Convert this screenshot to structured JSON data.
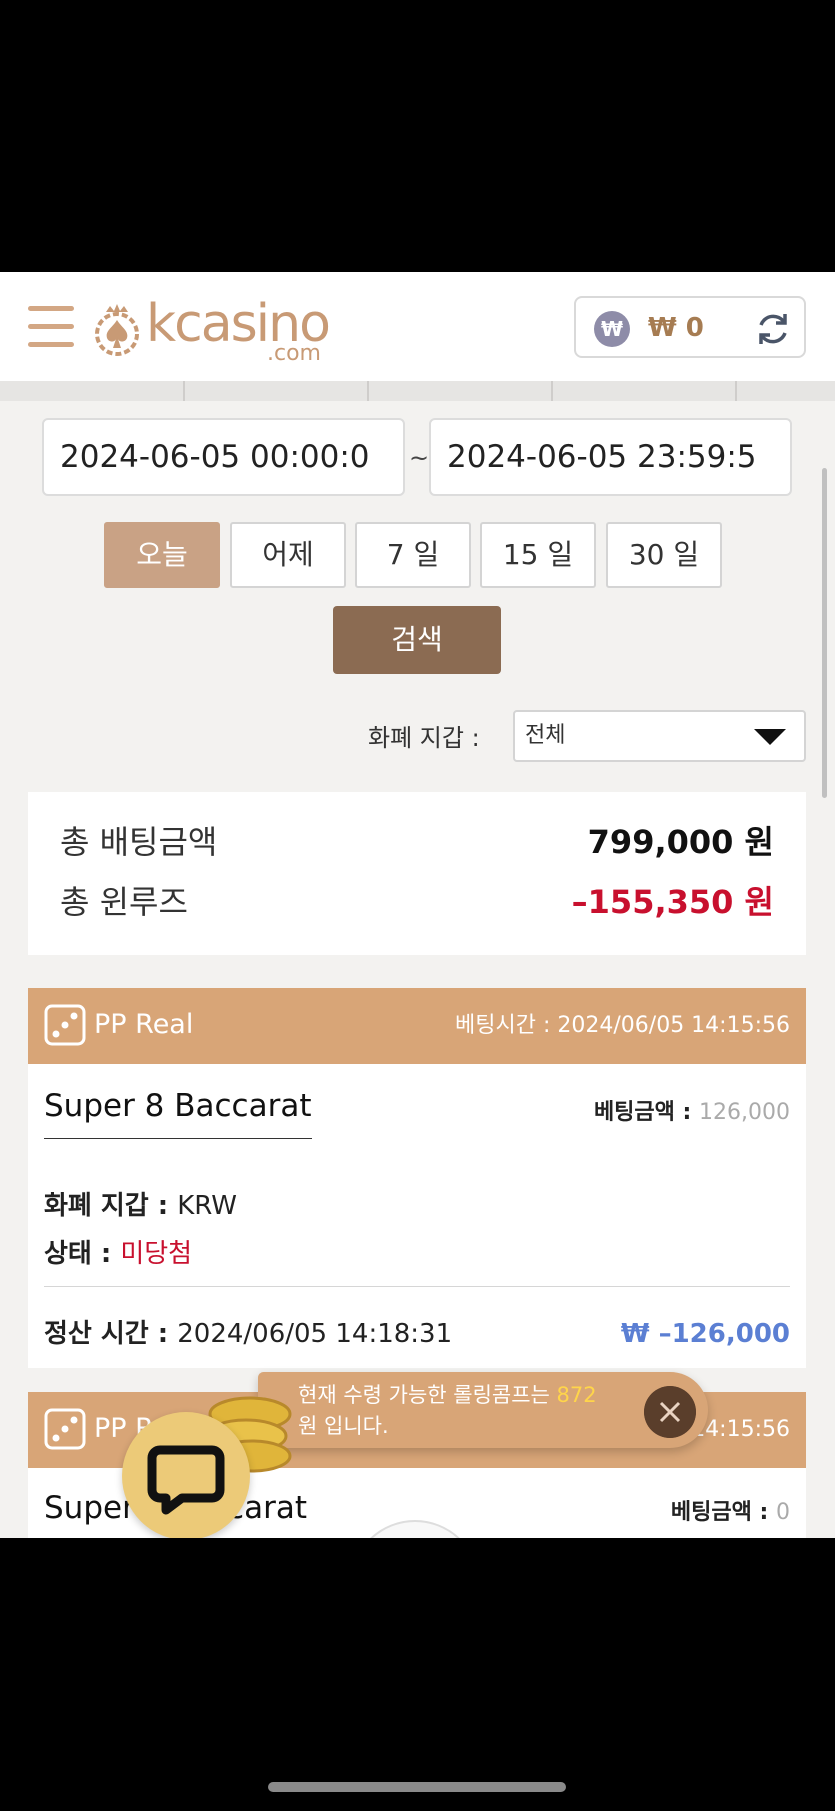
{
  "header": {
    "logo_text": "kcasino",
    "logo_sub": ".com",
    "wallet_symbol": "₩",
    "wallet_amount": "₩ 0"
  },
  "filters": {
    "date_from": "2024-06-05 00:00:0",
    "date_separator": "~",
    "date_to": "2024-06-05 23:59:5",
    "ranges": [
      "오늘",
      "어제",
      "7 일",
      "15 일",
      "30 일"
    ],
    "active_range": "오늘",
    "search_label": "검색",
    "wallet_label": "화폐 지갑 :",
    "wallet_value": "전체"
  },
  "totals": {
    "bet_label": "총 배팅금액",
    "bet_value": "799,000 원",
    "winloss_label": "총 윈루즈",
    "winloss_value": "–155,350 원"
  },
  "bets": [
    {
      "provider": "PP Real",
      "bet_time": "베팅시간 : 2024/06/05 14:15:56",
      "game": "Super 8 Baccarat",
      "amount_label": "베팅금액 : ",
      "amount": "126,000",
      "currency_label": "화폐 지갑 : ",
      "currency": "KRW",
      "status_label": "상태 : ",
      "status": "미당첨",
      "settle_label": "정산 시간 : ",
      "settle_time": "2024/06/05 14:18:31",
      "winloss": "₩ –126,000"
    },
    {
      "provider": "PP R",
      "bet_time": "14:15:56",
      "game_left": "Super",
      "game_right": "ccarat",
      "amount_label": "베팅금액 : ",
      "amount": "0"
    }
  ],
  "toast": {
    "line1_prefix": "현재 수령 가능한 롤링콤프는 ",
    "highlight": "872",
    "line2": "원 입니다."
  },
  "colors": {
    "accent": "#d8a577",
    "brown": "#8b6b52",
    "negative": "#c8102e",
    "winloss_blue": "#5b7fd3",
    "status_red": "#c8102e"
  }
}
